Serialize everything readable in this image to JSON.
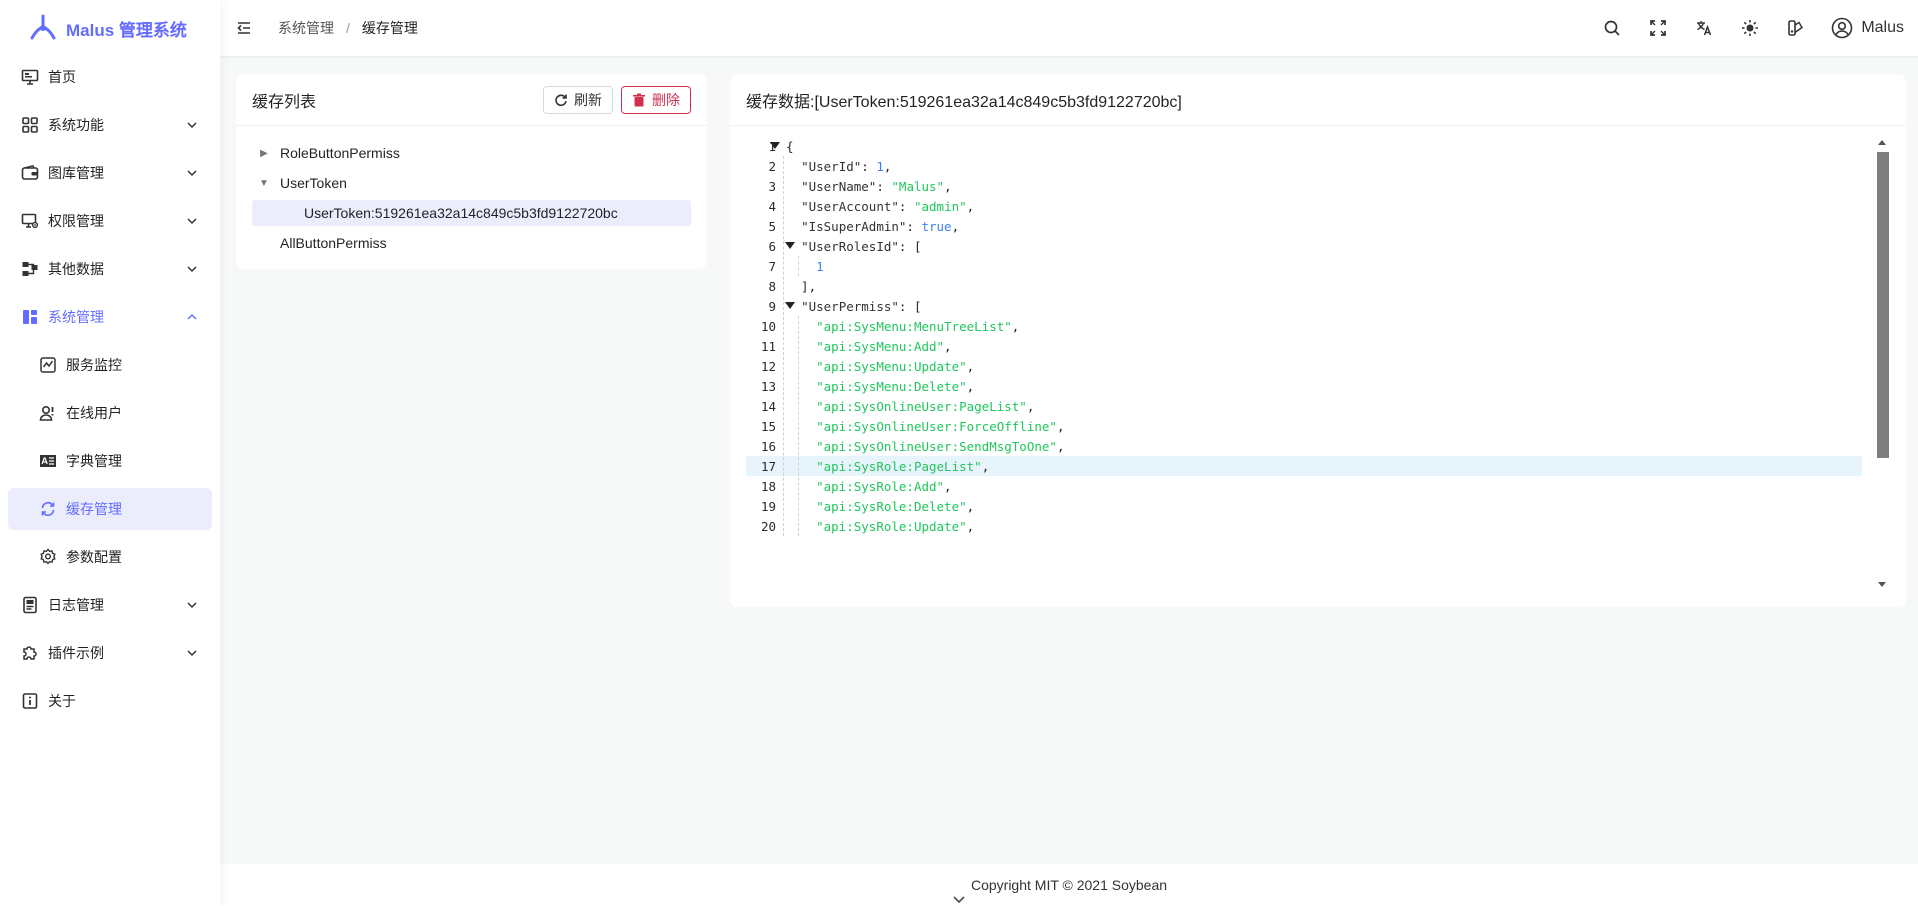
{
  "app": {
    "title": "Malus 管理系统"
  },
  "sidebar": {
    "items": [
      {
        "label": "首页",
        "icon": "monitor-icon",
        "expandable": false
      },
      {
        "label": "系统功能",
        "icon": "grid-icon",
        "expandable": true
      },
      {
        "label": "图库管理",
        "icon": "wallet-icon",
        "expandable": true
      },
      {
        "label": "权限管理",
        "icon": "permission-icon",
        "expandable": true
      },
      {
        "label": "其他数据",
        "icon": "data-icon",
        "expandable": true
      },
      {
        "label": "系统管理",
        "icon": "dashboard-icon",
        "expandable": true,
        "expanded": true
      },
      {
        "label": "服务监控",
        "icon": "chart-line-icon",
        "sub": true
      },
      {
        "label": "在线用户",
        "icon": "user-online-icon",
        "sub": true
      },
      {
        "label": "字典管理",
        "icon": "dictionary-icon",
        "sub": true
      },
      {
        "label": "缓存管理",
        "icon": "refresh-cache-icon",
        "sub": true,
        "selected": true
      },
      {
        "label": "参数配置",
        "icon": "settings-gear-icon",
        "sub": true
      },
      {
        "label": "日志管理",
        "icon": "log-icon",
        "expandable": true
      },
      {
        "label": "插件示例",
        "icon": "plugin-icon",
        "expandable": true
      },
      {
        "label": "关于",
        "icon": "info-icon",
        "expandable": false
      }
    ]
  },
  "header": {
    "breadcrumb": [
      "系统管理",
      "缓存管理"
    ],
    "separator": "/",
    "user_name": "Malus",
    "icons": [
      "search-icon",
      "fullscreen-icon",
      "translate-icon",
      "theme-sun-icon",
      "color-palette-icon",
      "user-avatar-icon"
    ]
  },
  "cache_list": {
    "title": "缓存列表",
    "refresh_label": "刷新",
    "delete_label": "删除",
    "tree": [
      {
        "label": "RoleButtonPermiss",
        "expanded": false
      },
      {
        "label": "UserToken",
        "expanded": true,
        "children": [
          "UserToken:519261ea32a14c849c5b3fd9122720bc"
        ]
      },
      {
        "label": "AllButtonPermiss",
        "leaf": true
      }
    ]
  },
  "cache_data": {
    "title": "缓存数据:[UserToken:519261ea32a14c849c5b3fd9122720bc]",
    "highlighted_line": 17,
    "lines": [
      "{",
      "  \"UserId\": 1,",
      "  \"UserName\": \"Malus\",",
      "  \"UserAccount\": \"admin\",",
      "  \"IsSuperAdmin\": true,",
      "  \"UserRolesId\": [",
      "    1",
      "  ],",
      "  \"UserPermiss\": [",
      "    \"api:SysMenu:MenuTreeList\",",
      "    \"api:SysMenu:Add\",",
      "    \"api:SysMenu:Update\",",
      "    \"api:SysMenu:Delete\",",
      "    \"api:SysOnlineUser:PageList\",",
      "    \"api:SysOnlineUser:ForceOffline\",",
      "    \"api:SysOnlineUser:SendMsgToOne\",",
      "    \"api:SysRole:PageList\",",
      "    \"api:SysRole:Add\",",
      "    \"api:SysRole:Delete\",",
      "    \"api:SysRole:Update\","
    ]
  },
  "footer": {
    "text": "Copyright MIT © 2021 Soybean"
  },
  "colors": {
    "primary": "#646cff",
    "danger": "#d03050",
    "string": "#22c55e",
    "number": "#3b82f6",
    "selected_bg": "#ebedfd"
  }
}
